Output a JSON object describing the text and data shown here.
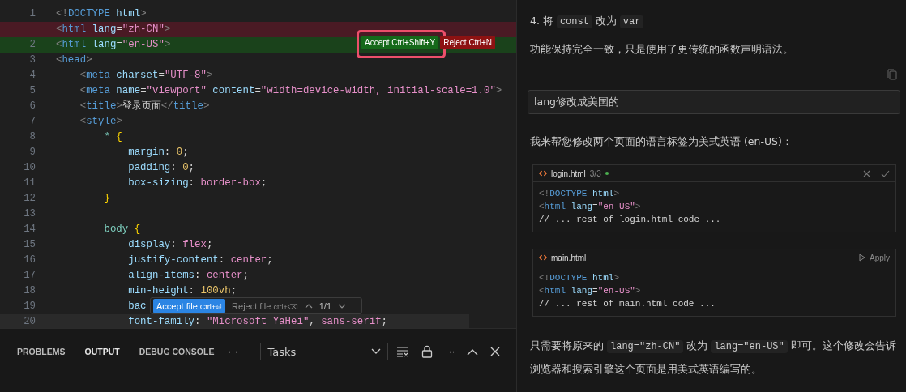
{
  "editor": {
    "lines": [
      {
        "number": "1",
        "kind": "context",
        "current": false,
        "tokens": [
          {
            "kind": "punct",
            "text": "<!"
          },
          {
            "kind": "tag",
            "text": "DOCTYPE"
          },
          {
            "kind": "attr",
            "text": " html"
          },
          {
            "kind": "punct",
            "text": ">"
          }
        ]
      },
      {
        "kind": "removed",
        "current": false,
        "tokens": [
          {
            "kind": "punct",
            "text": "<"
          },
          {
            "kind": "tag",
            "text": "html"
          },
          {
            "kind": "attr",
            "text": " lang"
          },
          {
            "kind": "op",
            "text": "="
          },
          {
            "kind": "str",
            "text": "\"zh-CN\""
          },
          {
            "kind": "punct",
            "text": ">"
          }
        ]
      },
      {
        "number": "2",
        "kind": "added",
        "current": false,
        "tokens": [
          {
            "kind": "punct",
            "text": "<"
          },
          {
            "kind": "tag",
            "text": "html"
          },
          {
            "kind": "attr",
            "text": " lang"
          },
          {
            "kind": "op",
            "text": "="
          },
          {
            "kind": "str",
            "text": "\"en-US\""
          },
          {
            "kind": "punct",
            "text": ">"
          }
        ]
      },
      {
        "number": "3",
        "kind": "context",
        "current": false,
        "tokens": [
          {
            "kind": "punct",
            "text": "<"
          },
          {
            "kind": "tag",
            "text": "head"
          },
          {
            "kind": "punct",
            "text": ">"
          }
        ]
      },
      {
        "number": "4",
        "kind": "context",
        "current": false,
        "tokens": [
          {
            "kind": "punct",
            "text": "    <"
          },
          {
            "kind": "tag",
            "text": "meta"
          },
          {
            "kind": "attr",
            "text": " charset"
          },
          {
            "kind": "op",
            "text": "="
          },
          {
            "kind": "str",
            "text": "\"UTF-8\""
          },
          {
            "kind": "punct",
            "text": ">"
          }
        ]
      },
      {
        "number": "5",
        "kind": "context",
        "current": false,
        "tokens": [
          {
            "kind": "punct",
            "text": "    <"
          },
          {
            "kind": "tag",
            "text": "meta"
          },
          {
            "kind": "attr",
            "text": " name"
          },
          {
            "kind": "op",
            "text": "="
          },
          {
            "kind": "str",
            "text": "\"viewport\""
          },
          {
            "kind": "attr",
            "text": " content"
          },
          {
            "kind": "op",
            "text": "="
          },
          {
            "kind": "str",
            "text": "\"width=device-width, initial-scale=1.0\""
          },
          {
            "kind": "punct",
            "text": ">"
          }
        ]
      },
      {
        "number": "6",
        "kind": "context",
        "current": false,
        "tokens": [
          {
            "kind": "punct",
            "text": "    <"
          },
          {
            "kind": "tag",
            "text": "title"
          },
          {
            "kind": "punct",
            "text": ">"
          },
          {
            "kind": "text",
            "text": "登录页面"
          },
          {
            "kind": "punct",
            "text": "</"
          },
          {
            "kind": "tag",
            "text": "title"
          },
          {
            "kind": "punct",
            "text": ">"
          }
        ]
      },
      {
        "number": "7",
        "kind": "context",
        "current": false,
        "tokens": [
          {
            "kind": "punct",
            "text": "    <"
          },
          {
            "kind": "tag",
            "text": "style"
          },
          {
            "kind": "punct",
            "text": ">"
          }
        ]
      },
      {
        "number": "8",
        "kind": "context",
        "current": false,
        "tokens": [
          {
            "kind": "sel",
            "text": "        *"
          },
          {
            "kind": "brace",
            "text": " {"
          }
        ]
      },
      {
        "number": "9",
        "kind": "context",
        "current": false,
        "tokens": [
          {
            "kind": "prop",
            "text": "            margin"
          },
          {
            "kind": "op",
            "text": ": "
          },
          {
            "kind": "num",
            "text": "0"
          },
          {
            "kind": "op",
            "text": ";"
          }
        ]
      },
      {
        "number": "10",
        "kind": "context",
        "current": false,
        "tokens": [
          {
            "kind": "prop",
            "text": "            padding"
          },
          {
            "kind": "op",
            "text": ": "
          },
          {
            "kind": "num",
            "text": "0"
          },
          {
            "kind": "op",
            "text": ";"
          }
        ]
      },
      {
        "number": "11",
        "kind": "context",
        "current": false,
        "tokens": [
          {
            "kind": "prop",
            "text": "            box-sizing"
          },
          {
            "kind": "op",
            "text": ": "
          },
          {
            "kind": "val",
            "text": "border-box"
          },
          {
            "kind": "op",
            "text": ";"
          }
        ]
      },
      {
        "number": "12",
        "kind": "context",
        "current": false,
        "tokens": [
          {
            "kind": "brace",
            "text": "        }"
          }
        ]
      },
      {
        "number": "13",
        "kind": "context",
        "current": false
      },
      {
        "number": "14",
        "kind": "context",
        "current": false,
        "tokens": [
          {
            "kind": "sel",
            "text": "        body"
          },
          {
            "kind": "brace",
            "text": " {"
          }
        ]
      },
      {
        "number": "15",
        "kind": "context",
        "current": false,
        "tokens": [
          {
            "kind": "prop",
            "text": "            display"
          },
          {
            "kind": "op",
            "text": ": "
          },
          {
            "kind": "val",
            "text": "flex"
          },
          {
            "kind": "op",
            "text": ";"
          }
        ]
      },
      {
        "number": "16",
        "kind": "context",
        "current": false,
        "tokens": [
          {
            "kind": "prop",
            "text": "            justify-content"
          },
          {
            "kind": "op",
            "text": ": "
          },
          {
            "kind": "val",
            "text": "center"
          },
          {
            "kind": "op",
            "text": ";"
          }
        ]
      },
      {
        "number": "17",
        "kind": "context",
        "current": false,
        "tokens": [
          {
            "kind": "prop",
            "text": "            align-items"
          },
          {
            "kind": "op",
            "text": ": "
          },
          {
            "kind": "val",
            "text": "center"
          },
          {
            "kind": "op",
            "text": ";"
          }
        ]
      },
      {
        "number": "18",
        "kind": "context",
        "current": false,
        "tokens": [
          {
            "kind": "prop",
            "text": "            min-height"
          },
          {
            "kind": "op",
            "text": ": "
          },
          {
            "kind": "num",
            "text": "100vh"
          },
          {
            "kind": "op",
            "text": ";"
          }
        ]
      },
      {
        "number": "19",
        "kind": "context",
        "current": false,
        "tokens": [
          {
            "kind": "prop",
            "text": "            bac"
          }
        ]
      },
      {
        "number": "20",
        "kind": "context",
        "current": true,
        "tokens": [
          {
            "kind": "prop",
            "text": "            font-family"
          },
          {
            "kind": "op",
            "text": ": "
          },
          {
            "kind": "str",
            "text": "\"Microsoft YaHei\""
          },
          {
            "kind": "op",
            "text": ", "
          },
          {
            "kind": "val",
            "text": "sans-serif"
          },
          {
            "kind": "op",
            "text": ";"
          }
        ]
      }
    ]
  },
  "change_actions": {
    "accept": "Accept",
    "accept_key": "Ctrl+Shift+Y",
    "reject": "Reject",
    "reject_key": "Ctrl+N"
  },
  "file_actions": {
    "accept": "Accept file",
    "accept_key": "Ctrl+⏎",
    "reject": "Reject file",
    "reject_key": "ctrl+⌫",
    "count": "1/1"
  },
  "panel": {
    "tabs": [
      {
        "label": "PROBLEMS",
        "selected": false
      },
      {
        "label": "OUTPUT",
        "selected": true
      },
      {
        "label": "DEBUG CONSOLE",
        "selected": false
      }
    ],
    "more": "···",
    "dropdown": "Tasks",
    "actions_more": "···"
  },
  "chat": {
    "blocks": [
      {
        "kind": "step",
        "parts": [
          {
            "kind": "text",
            "text": "4. 将 "
          },
          {
            "kind": "code",
            "text": "const"
          },
          {
            "kind": "text",
            "text": " 改为 "
          },
          {
            "kind": "code",
            "text": "var"
          }
        ]
      },
      {
        "kind": "paragraph",
        "parts": [
          {
            "kind": "text",
            "text": "功能保持完全一致，只是使用了更传统的函数声明语法。"
          }
        ]
      },
      {
        "kind": "copy"
      },
      {
        "kind": "user",
        "text": "lang修改成美国的"
      },
      {
        "kind": "paragraph",
        "parts": [
          {
            "kind": "text",
            "text": "我来帮您修改两个页面的语言标签为美式英语 (en-US)："
          }
        ]
      },
      {
        "kind": "codeblock",
        "file": "login.html",
        "status": "3/3",
        "modified": true,
        "reviewable": true,
        "lines": [
          [
            {
              "kind": "punct",
              "text": "<!"
            },
            {
              "kind": "tag",
              "text": "DOCTYPE"
            },
            {
              "kind": "attr",
              "text": " html"
            },
            {
              "kind": "punct",
              "text": ">"
            }
          ],
          [
            {
              "kind": "punct",
              "text": "<"
            },
            {
              "kind": "tag",
              "text": "html"
            },
            {
              "kind": "attr",
              "text": " lang"
            },
            {
              "kind": "op",
              "text": "="
            },
            {
              "kind": "str",
              "text": "\"en-US\""
            },
            {
              "kind": "punct",
              "text": ">"
            }
          ],
          [
            {
              "kind": "text",
              "text": "// ... rest of login.html code ..."
            }
          ]
        ]
      },
      {
        "kind": "codeblock",
        "file": "main.html",
        "modified": false,
        "reviewable": false,
        "action_label": "Apply",
        "lines": [
          [
            {
              "kind": "punct",
              "text": "<!"
            },
            {
              "kind": "tag",
              "text": "DOCTYPE"
            },
            {
              "kind": "attr",
              "text": " html"
            },
            {
              "kind": "punct",
              "text": ">"
            }
          ],
          [
            {
              "kind": "punct",
              "text": "<"
            },
            {
              "kind": "tag",
              "text": "html"
            },
            {
              "kind": "attr",
              "text": " lang"
            },
            {
              "kind": "op",
              "text": "="
            },
            {
              "kind": "str",
              "text": "\"en-US\""
            },
            {
              "kind": "punct",
              "text": ">"
            }
          ],
          [
            {
              "kind": "text",
              "text": "// ... rest of main.html code ..."
            }
          ]
        ]
      },
      {
        "kind": "paragraph",
        "parts": [
          {
            "kind": "text",
            "text": "只需要将原来的 "
          },
          {
            "kind": "code",
            "text": "lang=\"zh-CN\""
          },
          {
            "kind": "text",
            "text": " 改为 "
          },
          {
            "kind": "code",
            "text": "lang=\"en-US\""
          },
          {
            "kind": "text",
            "text": " 即可。这个修改会告诉浏览器和搜索引擎这个页面是用美式英语编写的。"
          }
        ]
      }
    ]
  }
}
